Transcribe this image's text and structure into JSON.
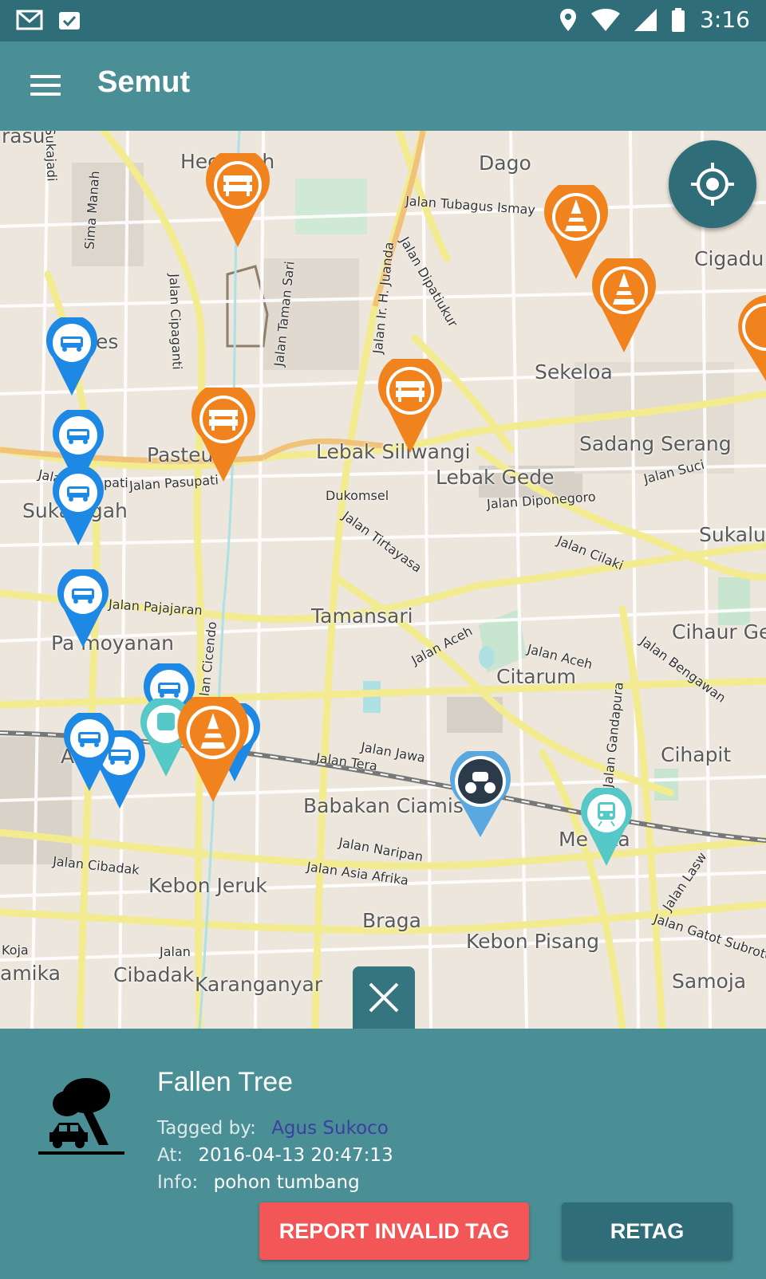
{
  "status_bar": {
    "time": "3:16",
    "icons": [
      "gmail-icon",
      "clipboard-check-icon",
      "location-icon",
      "wifi-icon",
      "signal-icon",
      "battery-icon"
    ]
  },
  "app_bar": {
    "title": "Semut",
    "menu_icon": "hamburger-icon"
  },
  "map": {
    "place_labels": [
      "Dago",
      "Sekeloa",
      "Cigadu",
      "Sadang Serang",
      "Lebak Siliwangi",
      "Lebak Gede",
      "Dukomsel",
      "Pasteu",
      "Suka ngah",
      "Sukalu",
      "Tamansari",
      "Citarum",
      "Cihaur Ge",
      "Pa moyanan",
      "Cihapit",
      "Babakan Ciamis",
      "Me eka",
      "Kebon Jeruk",
      "Braga",
      "Kebon Pisang",
      "Cibadak",
      "Karanganyar",
      "Samoja",
      "amika",
      "Koja",
      "Hec anah",
      "A",
      "es",
      "rasu"
    ],
    "road_labels": [
      "Jalan Tubagus Ismay",
      "Jalan Dipatiukur",
      "Jalan Ir. H. Juanda",
      "Jalan Taman Sari",
      "Jalan Cipaganti",
      "Sima Manah",
      "Sukajadi",
      "Jalan Pasupati",
      "Jala",
      "pati",
      "Jalan Tirtayasa",
      "Jalan Diponegoro",
      "Jalan Cilaki",
      "Jalan Suci",
      "Jalan Pajajaran",
      "Jalan Cicendo",
      "Jalan Aceh",
      "Jalan Aceh",
      "Jalan Bengawan",
      "Jalan Jawa",
      "Jalan Tera",
      "Jalan Gandapura",
      "Jalan Naripan",
      "Jalan Asia Afrika",
      "Jalan Cibadak",
      "Jalan Lasw",
      "Jalan Gatot Subroto",
      "Jalan"
    ],
    "locate_icon": "gps-locate-icon",
    "close_icon": "close-icon",
    "accent_colors": {
      "orange": "#f0831e",
      "blue": "#1e88e5",
      "teal": "#56c8c8",
      "navy": "#2f6e78"
    }
  },
  "panel": {
    "title": "Fallen Tree",
    "tagged_by_label": "Tagged by:",
    "tagged_by_value": "Agus Sukoco",
    "at_label": "At:",
    "at_value": "2016-04-13 20:47:13",
    "info_label": "Info:",
    "info_value": "pohon tumbang",
    "icon": "fallen-tree-icon",
    "report_button": "REPORT INVALID TAG",
    "retag_button": "RETAG"
  }
}
